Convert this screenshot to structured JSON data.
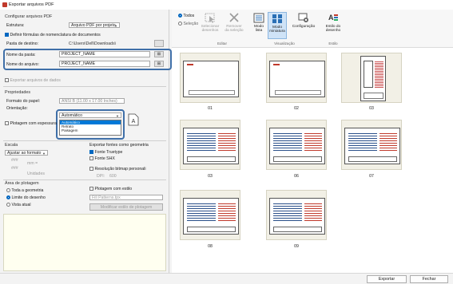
{
  "window": {
    "title": "Exportar arquivos PDF"
  },
  "left": {
    "section_configure": "Configurar arquivos PDF",
    "structure_label": "Estrutura:",
    "structure_value": "Arquivo PDF por projeto",
    "define_formulas_label": "Definir fórmulas de nomenclatura de documentos",
    "dest_folder_label": "Pasta de destino:",
    "dest_folder_value": "C:\\Users\\Dell\\Downloads\\",
    "folder_name_label": "Nome da pasta:",
    "folder_name_value": "PROJECT_NAME",
    "file_name_label": "Nome do arquivo:",
    "file_name_value": "PROJECT_NAME",
    "export_data_label": "Exportar arquivos de dados",
    "section_properties": "Propriedades",
    "paper_format_label": "Formato do papel:",
    "paper_format_value": "ANSI B (11.00 x 17.00 Inches)",
    "orientation_label": "Orientação:",
    "orientation_value": "Automático",
    "orientation_options": [
      "Automático",
      "Retrato",
      "Paisagem"
    ],
    "plot_lineweight_label": "Plotagem com espessura",
    "section_scale": "Escala",
    "scale_value": "Ajustar ao formato",
    "scale_mm_label": "mm =",
    "scale_hash_1": "###",
    "scale_hash_2": "###",
    "scale_units_label": "Unidades",
    "export_fonts_label": "Exportar fontes como geometria",
    "font_truetype_label": "Fonte Truetype",
    "font_shx_label": "Fonte SHX",
    "bitmap_res_label": "Resolução bitmap personali",
    "dpi_label": "DPI:",
    "dpi_value": "600",
    "section_plot_area": "Área de plotagem",
    "plot_all_label": "Toda a geometria",
    "plot_extents_label": "Limite do desenho",
    "plot_view_label": "Vista atual",
    "plot_style_label": "Plotagem com estilo",
    "plot_style_value": "Fill Patterns.tpx",
    "modify_style_label": "Modificar estilo de plotagem"
  },
  "ribbon": {
    "all_label": "Todos",
    "selection_label": "Seleção",
    "select_drawings_label": "Selecionar desenhos",
    "remove_selection_label": "Remover da seleção",
    "list_mode_label": "Modo lista",
    "thumb_mode_label": "Modo miniatura",
    "config_label": "Configuração",
    "style_label": "Estilo do desenho",
    "group_edit": "Editar",
    "group_view": "Visualização",
    "group_style": "Estilo"
  },
  "thumbnails": [
    {
      "label": "01"
    },
    {
      "label": "02"
    },
    {
      "label": "03"
    },
    {
      "label": "03"
    },
    {
      "label": "06"
    },
    {
      "label": "07"
    },
    {
      "label": "08"
    },
    {
      "label": "09"
    }
  ],
  "footer": {
    "export_label": "Exportar",
    "close_label": "Fechar"
  },
  "colors": {
    "accent": "#0067c0",
    "highlight_border": "#3f6fa8",
    "thumb_bg": "#f2f0e6",
    "selected_option": "#0078d7"
  }
}
